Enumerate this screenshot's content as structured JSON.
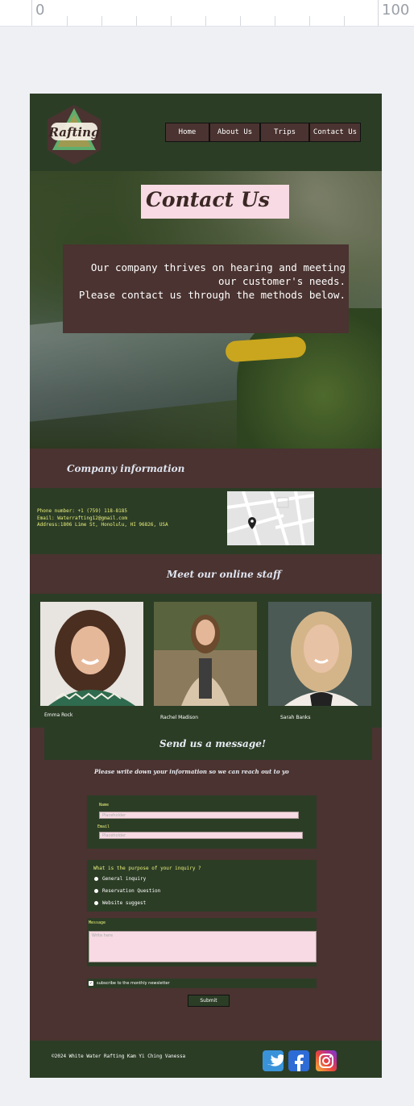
{
  "ruler": {
    "left_label": "0",
    "right_label": "100"
  },
  "header": {
    "logo_text": "Rafting",
    "nav": [
      "Home",
      "About Us",
      "Trips",
      "Contact Us"
    ]
  },
  "hero": {
    "title": "Contact Us",
    "message_line1": "Our company thrives on hearing and meeting",
    "message_line2": "our customer's needs.",
    "message_line3": "Please contact us through the methods below."
  },
  "company": {
    "heading": "Company information",
    "phone": "Phone number: +1 (759) 118-8185",
    "email": "Email: Waterrafting12@gmail.com",
    "address": "Address:1806 Lime St, Honolulu, HI 96826, USA"
  },
  "staff": {
    "heading": "Meet our online staff",
    "members": [
      "Emma Rock",
      "Rachel Madison",
      "Sarah Banks"
    ]
  },
  "form": {
    "heading": "Send us a message!",
    "subheading": "Please write down your information so we can reach out to yo",
    "name_label": "Name",
    "name_placeholder": "Placeholder",
    "email_label": "Email",
    "email_placeholder": "Placeholder",
    "purpose_question": "What is the purpose of your inquiry ?",
    "options": [
      "General inquiry",
      "Reservation Question",
      "Website suggest"
    ],
    "message_label": "Message",
    "message_placeholder": "Write here",
    "newsletter_label": "subscribe to the monthly newsletter",
    "submit_label": "Submit"
  },
  "footer": {
    "copyright": "©2024 White Water Rafting Kam Yi Ching Vanessa",
    "social": [
      "twitter-icon",
      "facebook-icon",
      "instagram-icon"
    ]
  },
  "colors": {
    "dark_green": "#2c3d26",
    "brown": "#4a3330",
    "pink": "#f7dae3",
    "yellow_text": "#e9f07a"
  }
}
